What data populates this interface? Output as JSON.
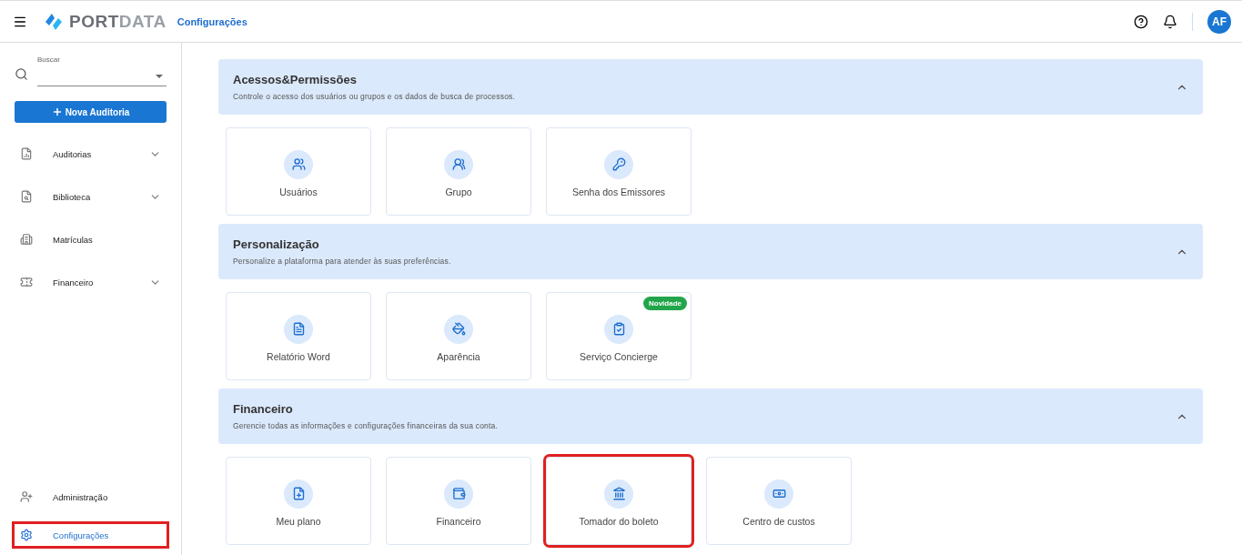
{
  "header": {
    "logo": {
      "part_1": "PORT",
      "part_2": "DATA"
    },
    "breadcrumb": "Configurações",
    "avatar": "AF"
  },
  "sidebar": {
    "search": {
      "label": "Buscar"
    },
    "new_button": "Nova Auditoria",
    "items": [
      {
        "label": "Auditorias",
        "expandable": true,
        "selected": false,
        "highlighted": false
      },
      {
        "label": "Biblioteca",
        "expandable": true,
        "selected": false,
        "highlighted": false
      },
      {
        "label": "Matrículas",
        "expandable": false,
        "selected": false,
        "highlighted": false
      },
      {
        "label": "Financeiro",
        "expandable": true,
        "selected": false,
        "highlighted": false
      }
    ],
    "bottom_items": [
      {
        "label": "Administração",
        "selected": false,
        "highlighted": false
      },
      {
        "label": "Configurações",
        "selected": true,
        "highlighted": true
      }
    ]
  },
  "sections": [
    {
      "title": "Acessos&Permissões",
      "description": "Controle o acesso dos usuários ou grupos e os dados de busca de processos.",
      "expanded": true,
      "cards": [
        {
          "label": "Usuários",
          "highlighted": false
        },
        {
          "label": "Grupo",
          "highlighted": false
        },
        {
          "label": "Senha dos Emissores",
          "highlighted": false
        }
      ]
    },
    {
      "title": "Personalização",
      "description": "Personalize a plataforma para atender às suas preferências.",
      "expanded": true,
      "cards": [
        {
          "label": "Relatório Word",
          "highlighted": false
        },
        {
          "label": "Aparência",
          "highlighted": false
        },
        {
          "label": "Serviço Concierge",
          "badge": "Novidade",
          "highlighted": false
        }
      ]
    },
    {
      "title": "Financeiro",
      "description": "Gerencie todas as informações e configurações financeiras da sua conta.",
      "expanded": true,
      "cards": [
        {
          "label": "Meu plano",
          "highlighted": false
        },
        {
          "label": "Financeiro",
          "highlighted": false
        },
        {
          "label": "Tomador do boleto",
          "highlighted": true
        },
        {
          "label": "Centro de custos",
          "highlighted": false
        }
      ]
    }
  ]
}
